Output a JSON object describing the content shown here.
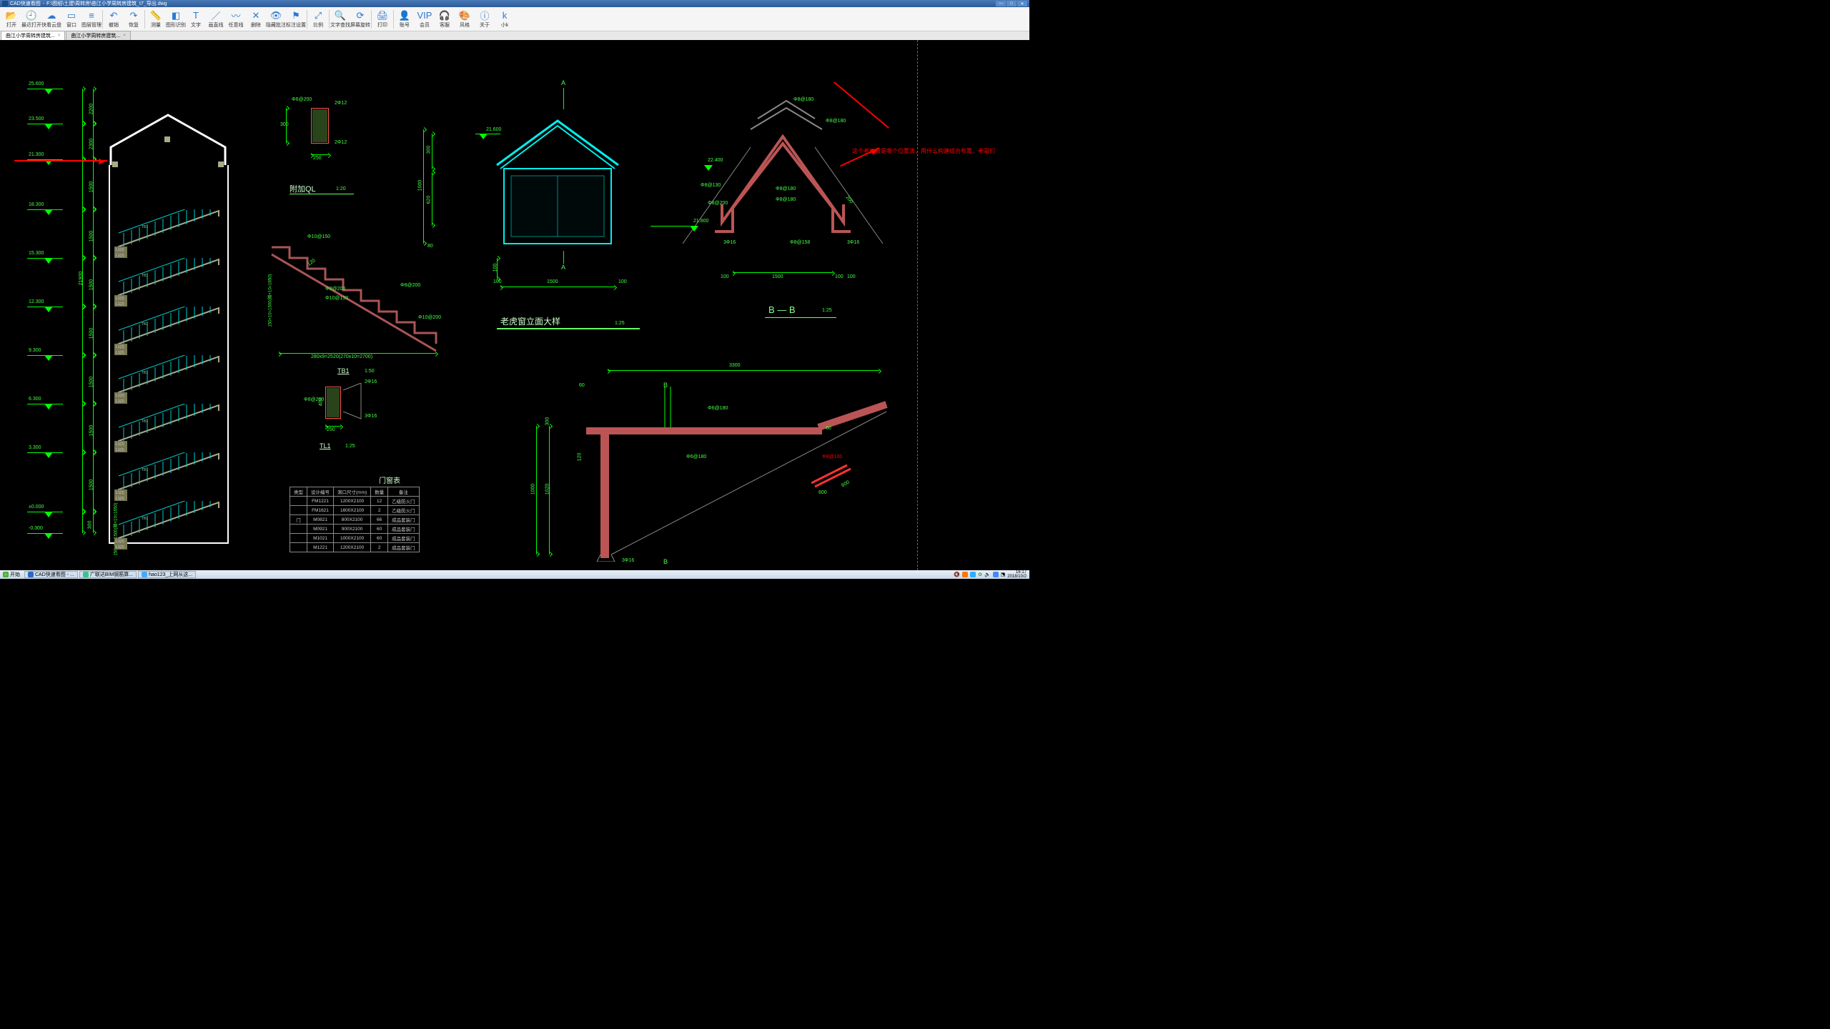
{
  "titlebar": {
    "app": "CAD快速看图",
    "path": "F:\\图纸\\土建\\周转房\\曲江小学周转房建筑_t7_导出.dwg"
  },
  "toolbar": [
    {
      "label": "打开",
      "icon": "📂",
      "name": "open-button"
    },
    {
      "label": "最近打开",
      "icon": "🕘",
      "name": "recent-button"
    },
    {
      "label": "快看云盘",
      "icon": "☁",
      "name": "cloud-button"
    },
    {
      "label": "窗口",
      "icon": "▭",
      "name": "window-button"
    },
    {
      "label": "图层管理",
      "icon": "≡",
      "name": "layer-button"
    },
    {
      "sep": true
    },
    {
      "label": "撤销",
      "icon": "↶",
      "name": "undo-button"
    },
    {
      "label": "恢复",
      "icon": "↷",
      "name": "redo-button"
    },
    {
      "sep": true
    },
    {
      "label": "测量",
      "icon": "📏",
      "name": "measure-button"
    },
    {
      "label": "图形识别",
      "icon": "◧",
      "name": "recognize-button"
    },
    {
      "label": "文字",
      "icon": "T",
      "name": "text-button"
    },
    {
      "label": "画直线",
      "icon": "／",
      "name": "line-button"
    },
    {
      "label": "任意线",
      "icon": "〰",
      "name": "polyline-button"
    },
    {
      "label": "删除",
      "icon": "✕",
      "name": "delete-button"
    },
    {
      "label": "隐藏批注",
      "icon": "👁",
      "name": "hide-note-button"
    },
    {
      "label": "标注设置",
      "icon": "⚑",
      "name": "anno-set-button"
    },
    {
      "sep": true
    },
    {
      "label": "比例",
      "icon": "⤢",
      "name": "scale-button"
    },
    {
      "sep": true
    },
    {
      "label": "文字查找",
      "icon": "🔍",
      "name": "find-button"
    },
    {
      "label": "屏幕旋转",
      "icon": "⟳",
      "name": "rotate-button"
    },
    {
      "sep": true
    },
    {
      "label": "打印",
      "icon": "🖨",
      "name": "print-button"
    },
    {
      "sep": true
    },
    {
      "label": "账号",
      "icon": "👤",
      "name": "account-button"
    },
    {
      "label": "会员",
      "icon": "VIP",
      "name": "vip-button"
    },
    {
      "label": "客服",
      "icon": "🎧",
      "name": "service-button"
    },
    {
      "label": "风格",
      "icon": "🎨",
      "name": "style-button"
    },
    {
      "label": "关于",
      "icon": "ⓘ",
      "name": "about-button"
    },
    {
      "label": "小k",
      "icon": "k",
      "name": "k-button"
    }
  ],
  "tabs": [
    "曲江小学周转房建筑...",
    "曲江小学周转房建筑..."
  ],
  "elevations": {
    "marks": [
      "25.600",
      "23.500",
      "21.300",
      "18.300",
      "15.300",
      "12.300",
      "9.300",
      "6.300",
      "3.300",
      "±0.000",
      "-0.300"
    ],
    "spans": [
      "2200",
      "2300",
      "1500",
      "1500",
      "1500",
      "1500",
      "1500",
      "1500",
      "1500",
      "300"
    ],
    "total": "21900",
    "bottom_note": "150×10=1500(踏×10=1650)"
  },
  "stair_labels": {
    "beam1": "TB1",
    "beam2": "L1(2)"
  },
  "ql_detail": {
    "title": "附加QL",
    "scale": "1:20",
    "top": "2Φ12",
    "bot": "2Φ12",
    "stirrup": "Φ6@200",
    "w": "250",
    "h": "300"
  },
  "tb_detail": {
    "title": "TB1",
    "scale": "1:50",
    "top": "Φ10@150",
    "bot": "Φ10@150",
    "dist1": "Φ8@200",
    "dist2": "Φ10@200",
    "bot2": "Φ10@150",
    "caption": "280x9=2520(270x10=2700)",
    "side": "150×10=1500(踏×10=1650)",
    "d": "120"
  },
  "tl_detail": {
    "title": "TL1",
    "scale": "1:25",
    "top": "2Φ16",
    "bot": "3Φ16",
    "stirrup": "Φ8@200",
    "w": "250",
    "h": "400"
  },
  "dormer": {
    "title": "老虎窗立面大样",
    "scale": "1:25",
    "mark_a": "A",
    "elev": "21.600",
    "w": "1500",
    "h": "1000",
    "win_h": "620",
    "top": "300",
    "b": "80",
    "side": "100"
  },
  "bb_section": {
    "title": "B — B",
    "scale": "1:25",
    "elev1": "22.400",
    "elev2": "21.800",
    "r1": "Φ8@180",
    "r2": "Φ8@130",
    "r3": "Φ8@200",
    "r4": "Φ8@180",
    "r5": "Φ8@158",
    "r6": "3Φ16",
    "w": "1500",
    "side": "100",
    "angle": "200"
  },
  "roof_detail": {
    "w": "3300",
    "h1": "1000",
    "h2": "1020",
    "h3": "120",
    "t": "300",
    "b_mark": "B",
    "angle": "60",
    "angle2": "3Φ16",
    "r1": "Φ6@180",
    "r2": "Φ6@180",
    "slope": "Φ8@100",
    "ext": "600"
  },
  "red_note": "这个老虎窗是哪个位置滴，用什么构建组合布置，老哥们",
  "dw_table": {
    "title": "门窗表",
    "headers": [
      "类型",
      "设计编号",
      "洞口尺寸(mm)",
      "数量",
      "备注"
    ],
    "rows": [
      [
        "",
        "FM1221",
        "1200X2100",
        "12",
        "乙级防火门"
      ],
      [
        "",
        "FM1621",
        "1600X2100",
        "2",
        "乙级防火门"
      ],
      [
        "门",
        "M0821",
        "800X2100",
        "66",
        "成品套装门"
      ],
      [
        "",
        "M0921",
        "900X2100",
        "60",
        "成品套装门"
      ],
      [
        "",
        "M1021",
        "1000X2100",
        "60",
        "成品套装门"
      ],
      [
        "",
        "M1221",
        "1200X2100",
        "2",
        "成品套装门"
      ]
    ]
  },
  "taskbar": {
    "start": "开始",
    "items": [
      "CAD快速看图 - ...",
      "广联达BIM钢筋算...",
      "hao123_上网从这..."
    ],
    "time": "16:17",
    "date": "2018/10/2"
  }
}
